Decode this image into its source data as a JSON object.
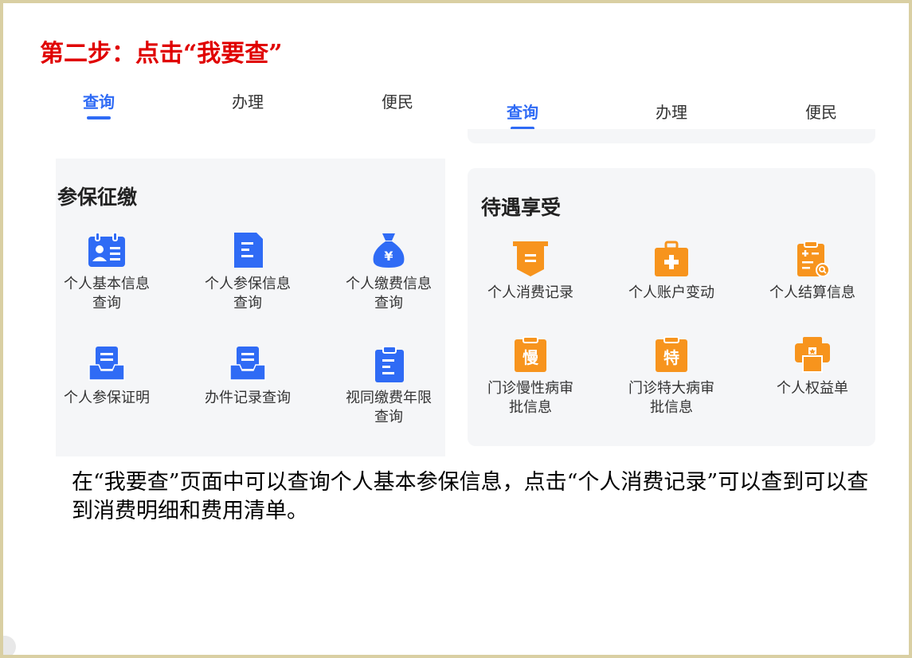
{
  "step_title": "第二步：点击“我要查”",
  "left": {
    "tabs": [
      {
        "label": "查询",
        "active": true
      },
      {
        "label": "办理",
        "active": false
      },
      {
        "label": "便民",
        "active": false
      }
    ],
    "section_title": "参保征缴",
    "items": [
      {
        "label": "个人基本信息\n查询",
        "icon": "personal-info-card-icon"
      },
      {
        "label": "个人参保信息\n查询",
        "icon": "document-icon"
      },
      {
        "label": "个人缴费信息\n查询",
        "icon": "money-bag-icon"
      },
      {
        "label": "个人参保证明",
        "icon": "inbox-certificate-icon"
      },
      {
        "label": "办件记录查询",
        "icon": "inbox-record-icon"
      },
      {
        "label": "视同缴费年限\n查询",
        "icon": "clipboard-icon"
      }
    ]
  },
  "right": {
    "tabs": [
      {
        "label": "查询",
        "active": true
      },
      {
        "label": "办理",
        "active": false
      },
      {
        "label": "便民",
        "active": false
      }
    ],
    "section_title": "待遇享受",
    "items": [
      {
        "label": "个人消费记录",
        "icon": "consumption-record-icon"
      },
      {
        "label": "个人账户变动",
        "icon": "medical-kit-icon"
      },
      {
        "label": "个人结算信息",
        "icon": "settlement-search-icon"
      },
      {
        "label": "门诊慢性病审\n批信息",
        "icon": "chronic-disease-icon",
        "glyph": "慢"
      },
      {
        "label": "门诊特大病审\n批信息",
        "icon": "major-disease-icon",
        "glyph": "特"
      },
      {
        "label": "个人权益单",
        "icon": "rights-printer-icon"
      }
    ]
  },
  "description": "在“我要查”页面中可以查询个人基本参保信息，点击“个人消费记录”可以查到可以查到消费明细和费用清单。",
  "colors": {
    "accent_blue": "#2f6bf5",
    "accent_orange": "#f7941d",
    "title_red": "#e00000"
  }
}
